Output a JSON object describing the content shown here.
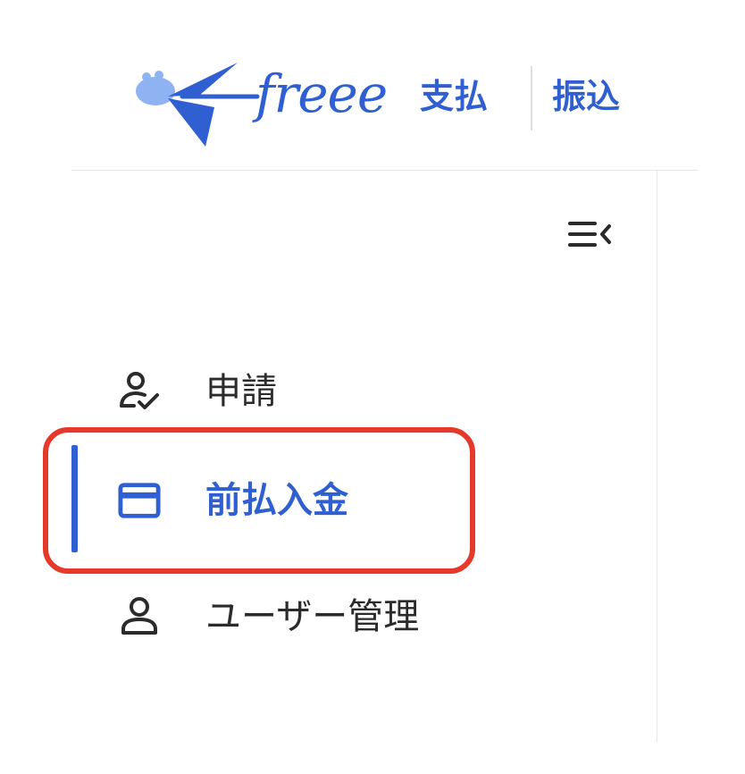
{
  "header": {
    "logo_word": "freee",
    "product_name": "支払",
    "product_sub": "振込"
  },
  "sidebar": {
    "collapse_icon": "collapse-menu-icon",
    "items": [
      {
        "label": "申請",
        "icon": "user-check-icon",
        "active": false
      },
      {
        "label": "前払入金",
        "icon": "credit-card-icon",
        "active": true
      },
      {
        "label": "ユーザー管理",
        "icon": "user-icon",
        "active": false
      }
    ]
  },
  "colors": {
    "brand": "#2f5fd0",
    "text": "#2b2b2b",
    "highlight": "#e5392b",
    "divider": "#e6e8ec"
  }
}
